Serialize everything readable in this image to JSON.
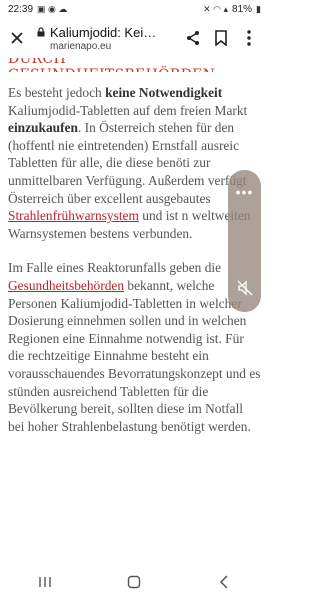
{
  "status_bar": {
    "time": "22:39",
    "battery": "81%"
  },
  "toolbar": {
    "title": "Kaliumjodid: Kei…",
    "url": "marienapo.eu"
  },
  "heading_fragment": "durch Gesundheitsbehörden",
  "article": {
    "p1": {
      "t1": "Es besteht jedoch ",
      "b1": "keine Notwendigkeit",
      "t2": " Kaliumjodid-Tabletten auf dem freien Markt ",
      "b2": "einzukaufen",
      "t3": ". In Österreich stehen für den (hoffentl nie eintretenden) Ernstfall ausreic Tabletten für alle, die diese benöti zur unmittelbaren Verfügung. Außerdem verfügt Österreich über excellent ausgebautes ",
      "link": "Strahlenfrühwarnsystem",
      "t4": " und ist n weltweiten Warnsystemen bestens verbunden."
    },
    "p2": {
      "t1": "Im Falle eines Reaktorunfalls geben die ",
      "link": "Gesundheitsbehörden",
      "t2": " bekannt, welche Personen Kaliumjodid-Tabletten in welcher Dosierung einnehmen sollen und in welchen Regionen eine Einnahme notwendig ist. Für die rechtzeitige Einnahme besteht ein vorausschauendes Bevorratungskonzept und es stünden ausreichend Tabletten für die Bevölkerung bereit, sollten diese im Notfall bei hoher Strahlenbelastung benötigt werden."
    }
  },
  "colors": {
    "link": "#c0212b",
    "heading": "#c0392b",
    "text": "#555555",
    "overlay": "#968779"
  },
  "icons": [
    "close-icon",
    "lock-icon",
    "share-icon",
    "bookmark-icon",
    "more-vert-icon",
    "mute-icon"
  ]
}
